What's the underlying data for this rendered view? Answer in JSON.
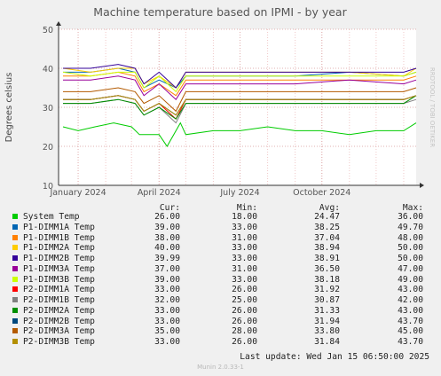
{
  "chart_data": {
    "type": "line",
    "title": "Machine temperature based on IPMI - by year",
    "ylabel": "Degrees celsius",
    "watermark": "RRDTOOL / TOBI OETIKER",
    "ylim": [
      10,
      50
    ],
    "yticks": [
      10,
      20,
      30,
      40,
      50
    ],
    "x_range": [
      "2023-12-10",
      "2025-01-15"
    ],
    "x_ticks": [
      {
        "label": "January 2024",
        "date": "2024-01-01"
      },
      {
        "label": "April 2024",
        "date": "2024-04-01"
      },
      {
        "label": "July 2024",
        "date": "2024-07-01"
      },
      {
        "label": "October 2024",
        "date": "2024-10-01"
      }
    ],
    "grid": true,
    "legend_headers": {
      "cur": "Cur:",
      "min": "Min:",
      "avg": "Avg:",
      "max": "Max:"
    },
    "series": [
      {
        "name": "System Temp",
        "color": "#00cc00",
        "cur": "26.00",
        "min": "18.00",
        "avg": "24.47",
        "max": "36.00",
        "x": [
          "2023-12-15",
          "2024-01-01",
          "2024-01-20",
          "2024-02-10",
          "2024-03-01",
          "2024-03-10",
          "2024-04-01",
          "2024-04-10",
          "2024-04-25",
          "2024-05-01",
          "2024-06-01",
          "2024-07-01",
          "2024-08-01",
          "2024-09-01",
          "2024-10-01",
          "2024-11-01",
          "2024-12-01",
          "2025-01-01",
          "2025-01-15"
        ],
        "values": [
          25,
          24,
          25,
          26,
          25,
          23,
          23,
          20,
          26,
          23,
          24,
          24,
          25,
          24,
          24,
          23,
          24,
          24,
          26
        ]
      },
      {
        "name": "P1-DIMM1A Temp",
        "color": "#0066b3",
        "cur": "39.00",
        "min": "33.00",
        "avg": "38.25",
        "max": "49.70",
        "x": [
          "2023-12-15",
          "2024-01-15",
          "2024-02-15",
          "2024-03-05",
          "2024-03-15",
          "2024-04-01",
          "2024-04-20",
          "2024-05-01",
          "2024-07-01",
          "2024-09-01",
          "2024-11-01",
          "2025-01-01",
          "2025-01-15"
        ],
        "values": [
          39,
          39,
          40,
          39,
          35,
          37,
          35,
          38,
          38,
          38,
          39,
          38,
          39
        ]
      },
      {
        "name": "P1-DIMM1B Temp",
        "color": "#ff8000",
        "cur": "38.00",
        "min": "31.00",
        "avg": "37.04",
        "max": "48.00",
        "x": [
          "2023-12-15",
          "2024-01-15",
          "2024-02-15",
          "2024-03-05",
          "2024-03-15",
          "2024-04-01",
          "2024-04-20",
          "2024-05-01",
          "2024-07-01",
          "2024-09-01",
          "2024-11-01",
          "2025-01-01",
          "2025-01-15"
        ],
        "values": [
          38,
          38,
          39,
          38,
          34,
          36,
          33,
          37,
          37,
          37,
          37,
          37,
          38
        ]
      },
      {
        "name": "P1-DIMM2A Temp",
        "color": "#ffcc00",
        "cur": "40.00",
        "min": "33.00",
        "avg": "38.94",
        "max": "50.00",
        "x": [
          "2023-12-15",
          "2024-01-15",
          "2024-02-15",
          "2024-03-05",
          "2024-03-15",
          "2024-04-01",
          "2024-04-20",
          "2024-05-01",
          "2024-07-01",
          "2024-09-01",
          "2024-11-01",
          "2025-01-01",
          "2025-01-15"
        ],
        "values": [
          40,
          39,
          40,
          40,
          36,
          38,
          35,
          39,
          39,
          39,
          39,
          38,
          40
        ]
      },
      {
        "name": "P1-DIMM2B Temp",
        "color": "#330099",
        "cur": "39.99",
        "min": "33.00",
        "avg": "38.91",
        "max": "50.00",
        "x": [
          "2023-12-15",
          "2024-01-15",
          "2024-02-15",
          "2024-03-05",
          "2024-03-15",
          "2024-04-01",
          "2024-04-20",
          "2024-05-01",
          "2024-07-01",
          "2024-09-01",
          "2024-11-01",
          "2025-01-01",
          "2025-01-15"
        ],
        "values": [
          40,
          40,
          41,
          40,
          36,
          39,
          35,
          39,
          39,
          39,
          39,
          39,
          40
        ]
      },
      {
        "name": "P1-DIMM3A Temp",
        "color": "#990099",
        "cur": "37.00",
        "min": "31.00",
        "avg": "36.50",
        "max": "47.00",
        "x": [
          "2023-12-15",
          "2024-01-15",
          "2024-02-15",
          "2024-03-05",
          "2024-03-15",
          "2024-04-01",
          "2024-04-20",
          "2024-05-01",
          "2024-07-01",
          "2024-09-01",
          "2024-11-01",
          "2025-01-01",
          "2025-01-15"
        ],
        "values": [
          37,
          37,
          38,
          37,
          33,
          36,
          32,
          36,
          36,
          36,
          37,
          36,
          37
        ]
      },
      {
        "name": "P1-DIMM3B Temp",
        "color": "#ccff00",
        "cur": "39.00",
        "min": "33.00",
        "avg": "38.18",
        "max": "49.00",
        "x": [
          "2023-12-15",
          "2024-01-15",
          "2024-02-15",
          "2024-03-05",
          "2024-03-15",
          "2024-04-01",
          "2024-04-20",
          "2024-05-01",
          "2024-07-01",
          "2024-09-01",
          "2024-11-01",
          "2025-01-01",
          "2025-01-15"
        ],
        "values": [
          39,
          38,
          39,
          39,
          35,
          38,
          34,
          38,
          38,
          38,
          38,
          38,
          39
        ]
      },
      {
        "name": "P2-DIMM1A Temp",
        "color": "#ff0000",
        "cur": "33.00",
        "min": "26.00",
        "avg": "31.92",
        "max": "43.00",
        "x": [
          "2023-12-15",
          "2024-01-15",
          "2024-02-15",
          "2024-03-05",
          "2024-03-15",
          "2024-04-01",
          "2024-04-20",
          "2024-05-01",
          "2024-07-01",
          "2024-09-01",
          "2024-11-01",
          "2025-01-01",
          "2025-01-15"
        ],
        "values": [
          32,
          32,
          33,
          32,
          29,
          31,
          27,
          32,
          32,
          32,
          32,
          32,
          33
        ]
      },
      {
        "name": "P2-DIMM1B Temp",
        "color": "#808080",
        "cur": "32.00",
        "min": "25.00",
        "avg": "30.87",
        "max": "42.00",
        "x": [
          "2023-12-15",
          "2024-01-15",
          "2024-02-15",
          "2024-03-05",
          "2024-03-15",
          "2024-04-01",
          "2024-04-20",
          "2024-05-01",
          "2024-07-01",
          "2024-09-01",
          "2024-11-01",
          "2025-01-01",
          "2025-01-15"
        ],
        "values": [
          31,
          31,
          32,
          31,
          28,
          30,
          26,
          31,
          31,
          31,
          31,
          31,
          32
        ]
      },
      {
        "name": "P2-DIMM2A Temp",
        "color": "#008f00",
        "cur": "33.00",
        "min": "26.00",
        "avg": "31.33",
        "max": "43.00",
        "x": [
          "2023-12-15",
          "2024-01-15",
          "2024-02-15",
          "2024-03-05",
          "2024-03-15",
          "2024-04-01",
          "2024-04-20",
          "2024-05-01",
          "2024-07-01",
          "2024-09-01",
          "2024-11-01",
          "2025-01-01",
          "2025-01-15"
        ],
        "values": [
          31,
          31,
          32,
          31,
          28,
          30,
          27,
          31,
          31,
          31,
          31,
          31,
          33
        ]
      },
      {
        "name": "P2-DIMM2B Temp",
        "color": "#00487d",
        "cur": "33.00",
        "min": "26.00",
        "avg": "31.94",
        "max": "43.70",
        "x": [
          "2023-12-15",
          "2024-01-15",
          "2024-02-15",
          "2024-03-05",
          "2024-03-15",
          "2024-04-01",
          "2024-04-20",
          "2024-05-01",
          "2024-07-01",
          "2024-09-01",
          "2024-11-01",
          "2025-01-01",
          "2025-01-15"
        ],
        "values": [
          32,
          32,
          33,
          32,
          29,
          31,
          28,
          32,
          32,
          32,
          32,
          32,
          33
        ]
      },
      {
        "name": "P2-DIMM3A Temp",
        "color": "#b35a00",
        "cur": "35.00",
        "min": "28.00",
        "avg": "33.80",
        "max": "45.00",
        "x": [
          "2023-12-15",
          "2024-01-15",
          "2024-02-15",
          "2024-03-05",
          "2024-03-15",
          "2024-04-01",
          "2024-04-20",
          "2024-05-01",
          "2024-07-01",
          "2024-09-01",
          "2024-11-01",
          "2025-01-01",
          "2025-01-15"
        ],
        "values": [
          34,
          34,
          35,
          34,
          31,
          33,
          29,
          34,
          34,
          34,
          34,
          34,
          35
        ]
      },
      {
        "name": "P2-DIMM3B Temp",
        "color": "#b38f00",
        "cur": "33.00",
        "min": "26.00",
        "avg": "31.84",
        "max": "43.70",
        "x": [
          "2023-12-15",
          "2024-01-15",
          "2024-02-15",
          "2024-03-05",
          "2024-03-15",
          "2024-04-01",
          "2024-04-20",
          "2024-05-01",
          "2024-07-01",
          "2024-09-01",
          "2024-11-01",
          "2025-01-01",
          "2025-01-15"
        ],
        "values": [
          32,
          32,
          33,
          32,
          29,
          31,
          28,
          32,
          32,
          32,
          32,
          32,
          33
        ]
      }
    ]
  },
  "footer": {
    "last_update": "Last update:  Wed Jan 15 06:50:00 2025",
    "version": "Munin 2.0.33-1"
  }
}
